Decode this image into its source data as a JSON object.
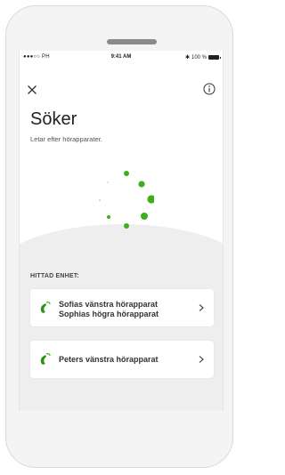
{
  "status_bar": {
    "signal": "●●●○○ PH",
    "time": "9:41 AM",
    "battery": "100 %"
  },
  "header": {
    "close_icon": "close-icon",
    "info_icon": "info-icon"
  },
  "main": {
    "title": "Söker",
    "subtitle": "Letar efter hörapparater.",
    "spinner_color": "#3cb01c"
  },
  "found_section": {
    "label": "HITTAD ENHET:",
    "devices": [
      {
        "line1": "Sofias vänstra hörapparat",
        "line2": "Sophias högra hörapparat"
      },
      {
        "line1": "Peters vänstra hörapparat"
      }
    ]
  },
  "colors": {
    "accent": "#3cb01c",
    "background": "#ffffff",
    "card": "#ffffff",
    "lower_panel": "#eeeeee"
  }
}
